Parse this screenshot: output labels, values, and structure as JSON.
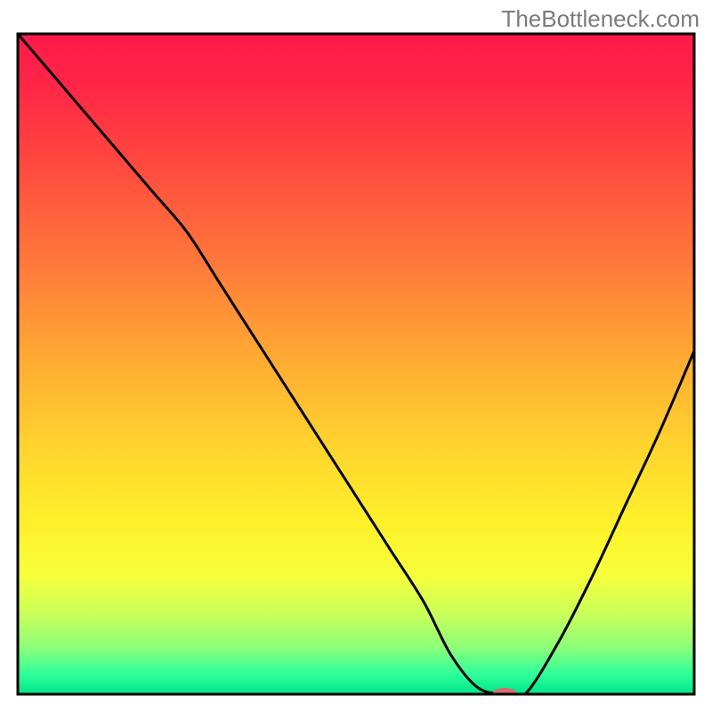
{
  "watermark": "TheBottleneck.com",
  "chart_data": {
    "type": "line",
    "title": "",
    "xlabel": "",
    "ylabel": "",
    "xlim": [
      0,
      100
    ],
    "ylim": [
      0,
      100
    ],
    "background_gradient": {
      "stops": [
        {
          "pos": 0.0,
          "color": "#ff1a4b"
        },
        {
          "pos": 0.08,
          "color": "#ff2646"
        },
        {
          "pos": 0.2,
          "color": "#ff4a3f"
        },
        {
          "pos": 0.35,
          "color": "#ff7a3a"
        },
        {
          "pos": 0.5,
          "color": "#ffad33"
        },
        {
          "pos": 0.62,
          "color": "#ffd22e"
        },
        {
          "pos": 0.74,
          "color": "#fff02a"
        },
        {
          "pos": 0.82,
          "color": "#f6ff3a"
        },
        {
          "pos": 0.88,
          "color": "#c8ff5a"
        },
        {
          "pos": 0.93,
          "color": "#8aff7a"
        },
        {
          "pos": 0.97,
          "color": "#2dff9a"
        },
        {
          "pos": 1.0,
          "color": "#00e58a"
        }
      ]
    },
    "series": [
      {
        "name": "bottleneck-curve",
        "color": "#000000",
        "width": 3,
        "x": [
          0,
          5,
          10,
          15,
          20,
          25,
          30,
          35,
          40,
          45,
          50,
          55,
          60,
          64,
          68,
          72,
          75,
          80,
          85,
          90,
          95,
          100
        ],
        "y": [
          100,
          94,
          88,
          82,
          76,
          70,
          62,
          54,
          46,
          38,
          30,
          22,
          14,
          6,
          1,
          0,
          0,
          8,
          18,
          29,
          40,
          52
        ]
      }
    ],
    "marker": {
      "name": "optimal-point",
      "x": 72,
      "y": 0,
      "color": "#d96a6f",
      "rx": 14,
      "ry": 7
    },
    "axes": {
      "frame_color": "#000000",
      "frame_width": 3,
      "show_ticks": false,
      "show_grid": false
    }
  }
}
